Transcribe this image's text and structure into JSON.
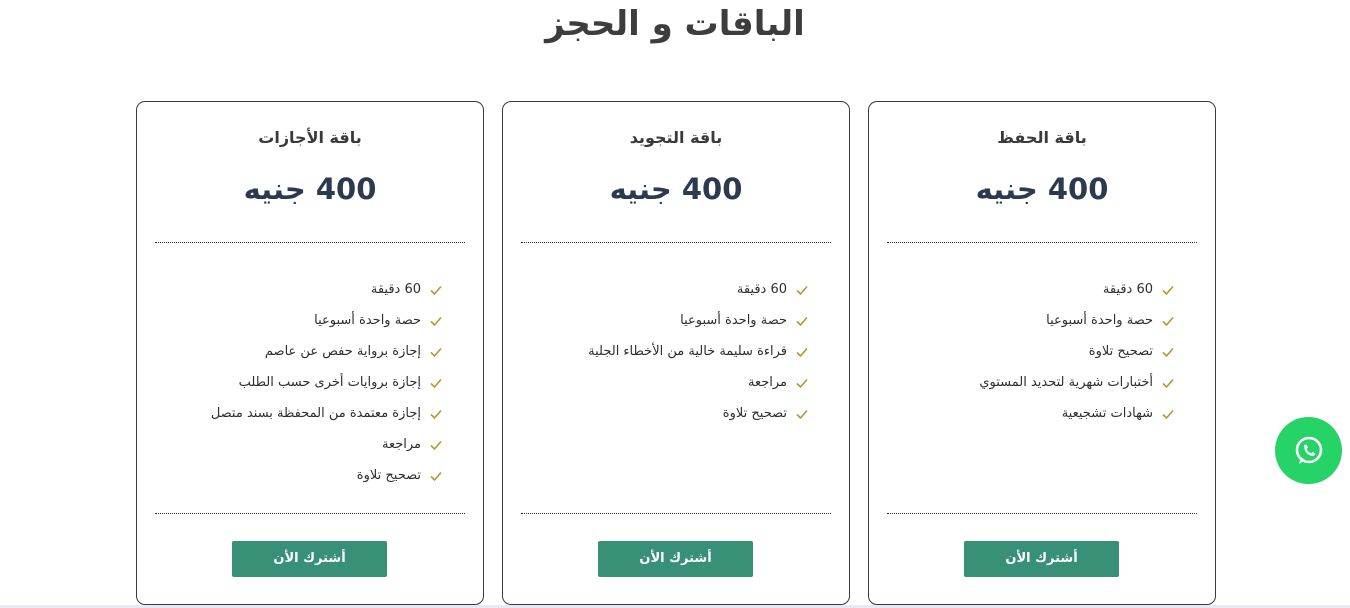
{
  "page": {
    "title": "الباقات و الحجز"
  },
  "colors": {
    "accent": "#389176",
    "check": "#b8962e",
    "price": "#2c3a4f",
    "whatsapp": "#25d366"
  },
  "packages": [
    {
      "name": "باقة الحفظ",
      "price": "400 جنيه",
      "features": [
        "60 دقيقة",
        "حصة واحدة أسبوعيا",
        "تصحيح تلاوة",
        "أختبارات شهرية لتحديد المستوي",
        "شهادات تشجيعية"
      ],
      "button": "أشترك الأن"
    },
    {
      "name": "باقة التجويد",
      "price": "400 جنيه",
      "features": [
        "60 دقيقة",
        "حصة واحدة أسبوعيا",
        "قراءة سليمة خالية من الأخطاء الجلية",
        "مراجعة",
        "تصحيح تلاوة"
      ],
      "button": "أشترك الأن"
    },
    {
      "name": "باقة الأجازات",
      "price": "400 جنيه",
      "features": [
        "60 دقيقة",
        "حصة واحدة أسبوعيا",
        "إجازة برواية حفص عن عاصم",
        "إجازة بروايات أخرى حسب الطلب",
        "إجازة معتمدة من المحفظة بسند متصل",
        "مراجعة",
        "تصحيح تلاوة"
      ],
      "button": "أشترك الأن"
    }
  ],
  "icons": {
    "check": "check-icon",
    "whatsapp": "whatsapp-icon"
  }
}
